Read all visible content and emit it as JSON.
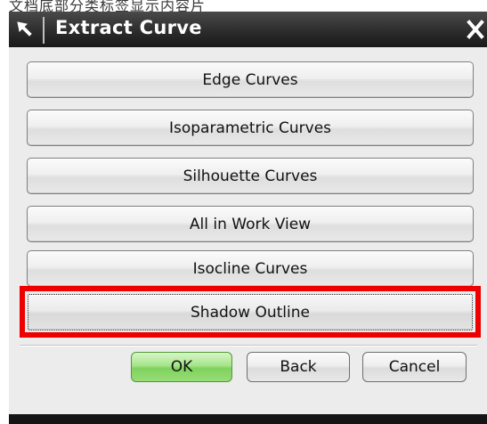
{
  "window": {
    "title": "Extract Curve"
  },
  "top_strip_text": "文档底部分类标签显示内容片",
  "options": [
    {
      "label": "Edge Curves"
    },
    {
      "label": "Isoparametric Curves"
    },
    {
      "label": "Silhouette Curves"
    },
    {
      "label": "All in Work View"
    },
    {
      "label": "Isocline Curves"
    },
    {
      "label": "Shadow Outline",
      "highlighted": true
    }
  ],
  "actions": {
    "ok_label": "OK",
    "back_label": "Back",
    "cancel_label": "Cancel"
  },
  "icons": {
    "title": "arrow-cursor-icon",
    "close": "close-icon"
  },
  "colors": {
    "titlebar": "#2a2a2a",
    "highlight": "#ee0000",
    "ok_button": "#a6e58a",
    "panel": "#ececec"
  }
}
